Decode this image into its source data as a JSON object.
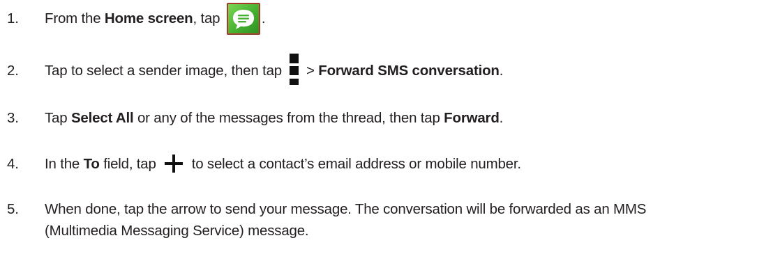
{
  "steps": [
    {
      "num": "1.",
      "before": "From the ",
      "bold": "Home screen",
      "after": ", tap ",
      "end": "."
    },
    {
      "num": "2.",
      "before": "Tap to select a sender image, then tap ",
      "between": " > ",
      "bold": "Forward SMS conversation",
      "end": "."
    },
    {
      "num": "3.",
      "before": "Tap ",
      "bold1": "Select All",
      "middle": " or any of the messages from the thread, then tap ",
      "bold2": "Forward",
      "end": "."
    },
    {
      "num": "4.",
      "before": "In the ",
      "bold": "To",
      "middle": " field, tap ",
      "after": " to select a contact’s email address or mobile number."
    },
    {
      "num": "5.",
      "line1": "When done, tap the arrow to send your message. The conversation will be forwarded as an MMS",
      "line2": "(Multimedia Messaging Service) message."
    }
  ],
  "icons": {
    "messaging": "messaging-app-icon",
    "menu": "overflow-menu-icon",
    "plus": "plus-icon"
  },
  "colors": {
    "text": "#231f20",
    "messaging_green": "#46b030"
  }
}
